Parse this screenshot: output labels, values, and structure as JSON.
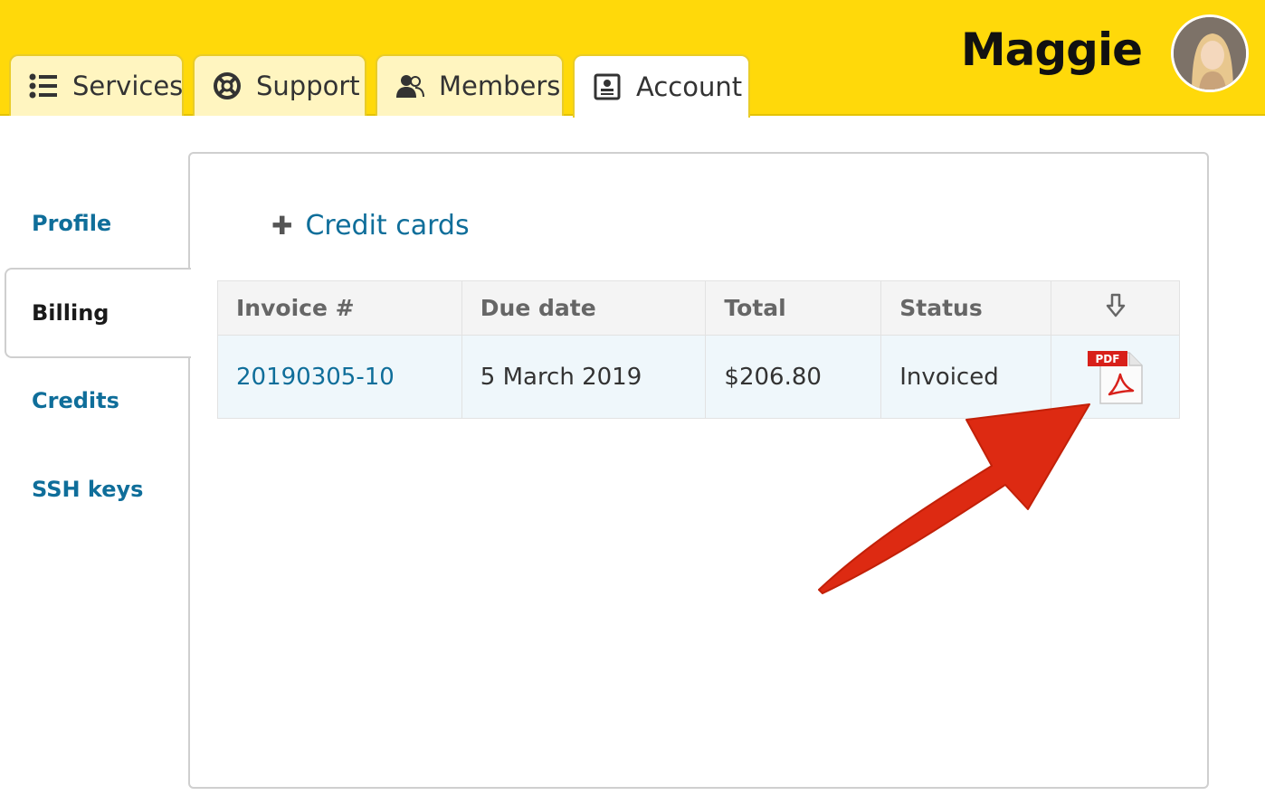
{
  "header": {
    "tabs": [
      {
        "label": "Services",
        "icon": "list-icon"
      },
      {
        "label": "Support",
        "icon": "lifebuoy-icon"
      },
      {
        "label": "Members",
        "icon": "users-icon"
      },
      {
        "label": "Account",
        "icon": "contact-card-icon"
      }
    ],
    "active_tab": "Account",
    "user_name": "Maggie"
  },
  "sidebar": {
    "items": [
      {
        "label": "Profile"
      },
      {
        "label": "Billing"
      },
      {
        "label": "Credits"
      },
      {
        "label": "SSH keys"
      }
    ],
    "active": "Billing"
  },
  "main": {
    "credit_cards_link": "Credit cards",
    "table": {
      "headers": [
        "Invoice #",
        "Due date",
        "Total",
        "Status"
      ],
      "download_header_icon": "download-arrow-icon",
      "rows": [
        {
          "invoice": "20190305-10",
          "due_date": "5 March 2019",
          "total": "$206.80",
          "status": "Invoiced",
          "file_icon": "pdf-icon",
          "pdf_badge": "PDF"
        }
      ]
    }
  },
  "colors": {
    "header_bg": "#ffd90a",
    "link": "#0f6e9a",
    "arrow": "#dd2a12"
  }
}
